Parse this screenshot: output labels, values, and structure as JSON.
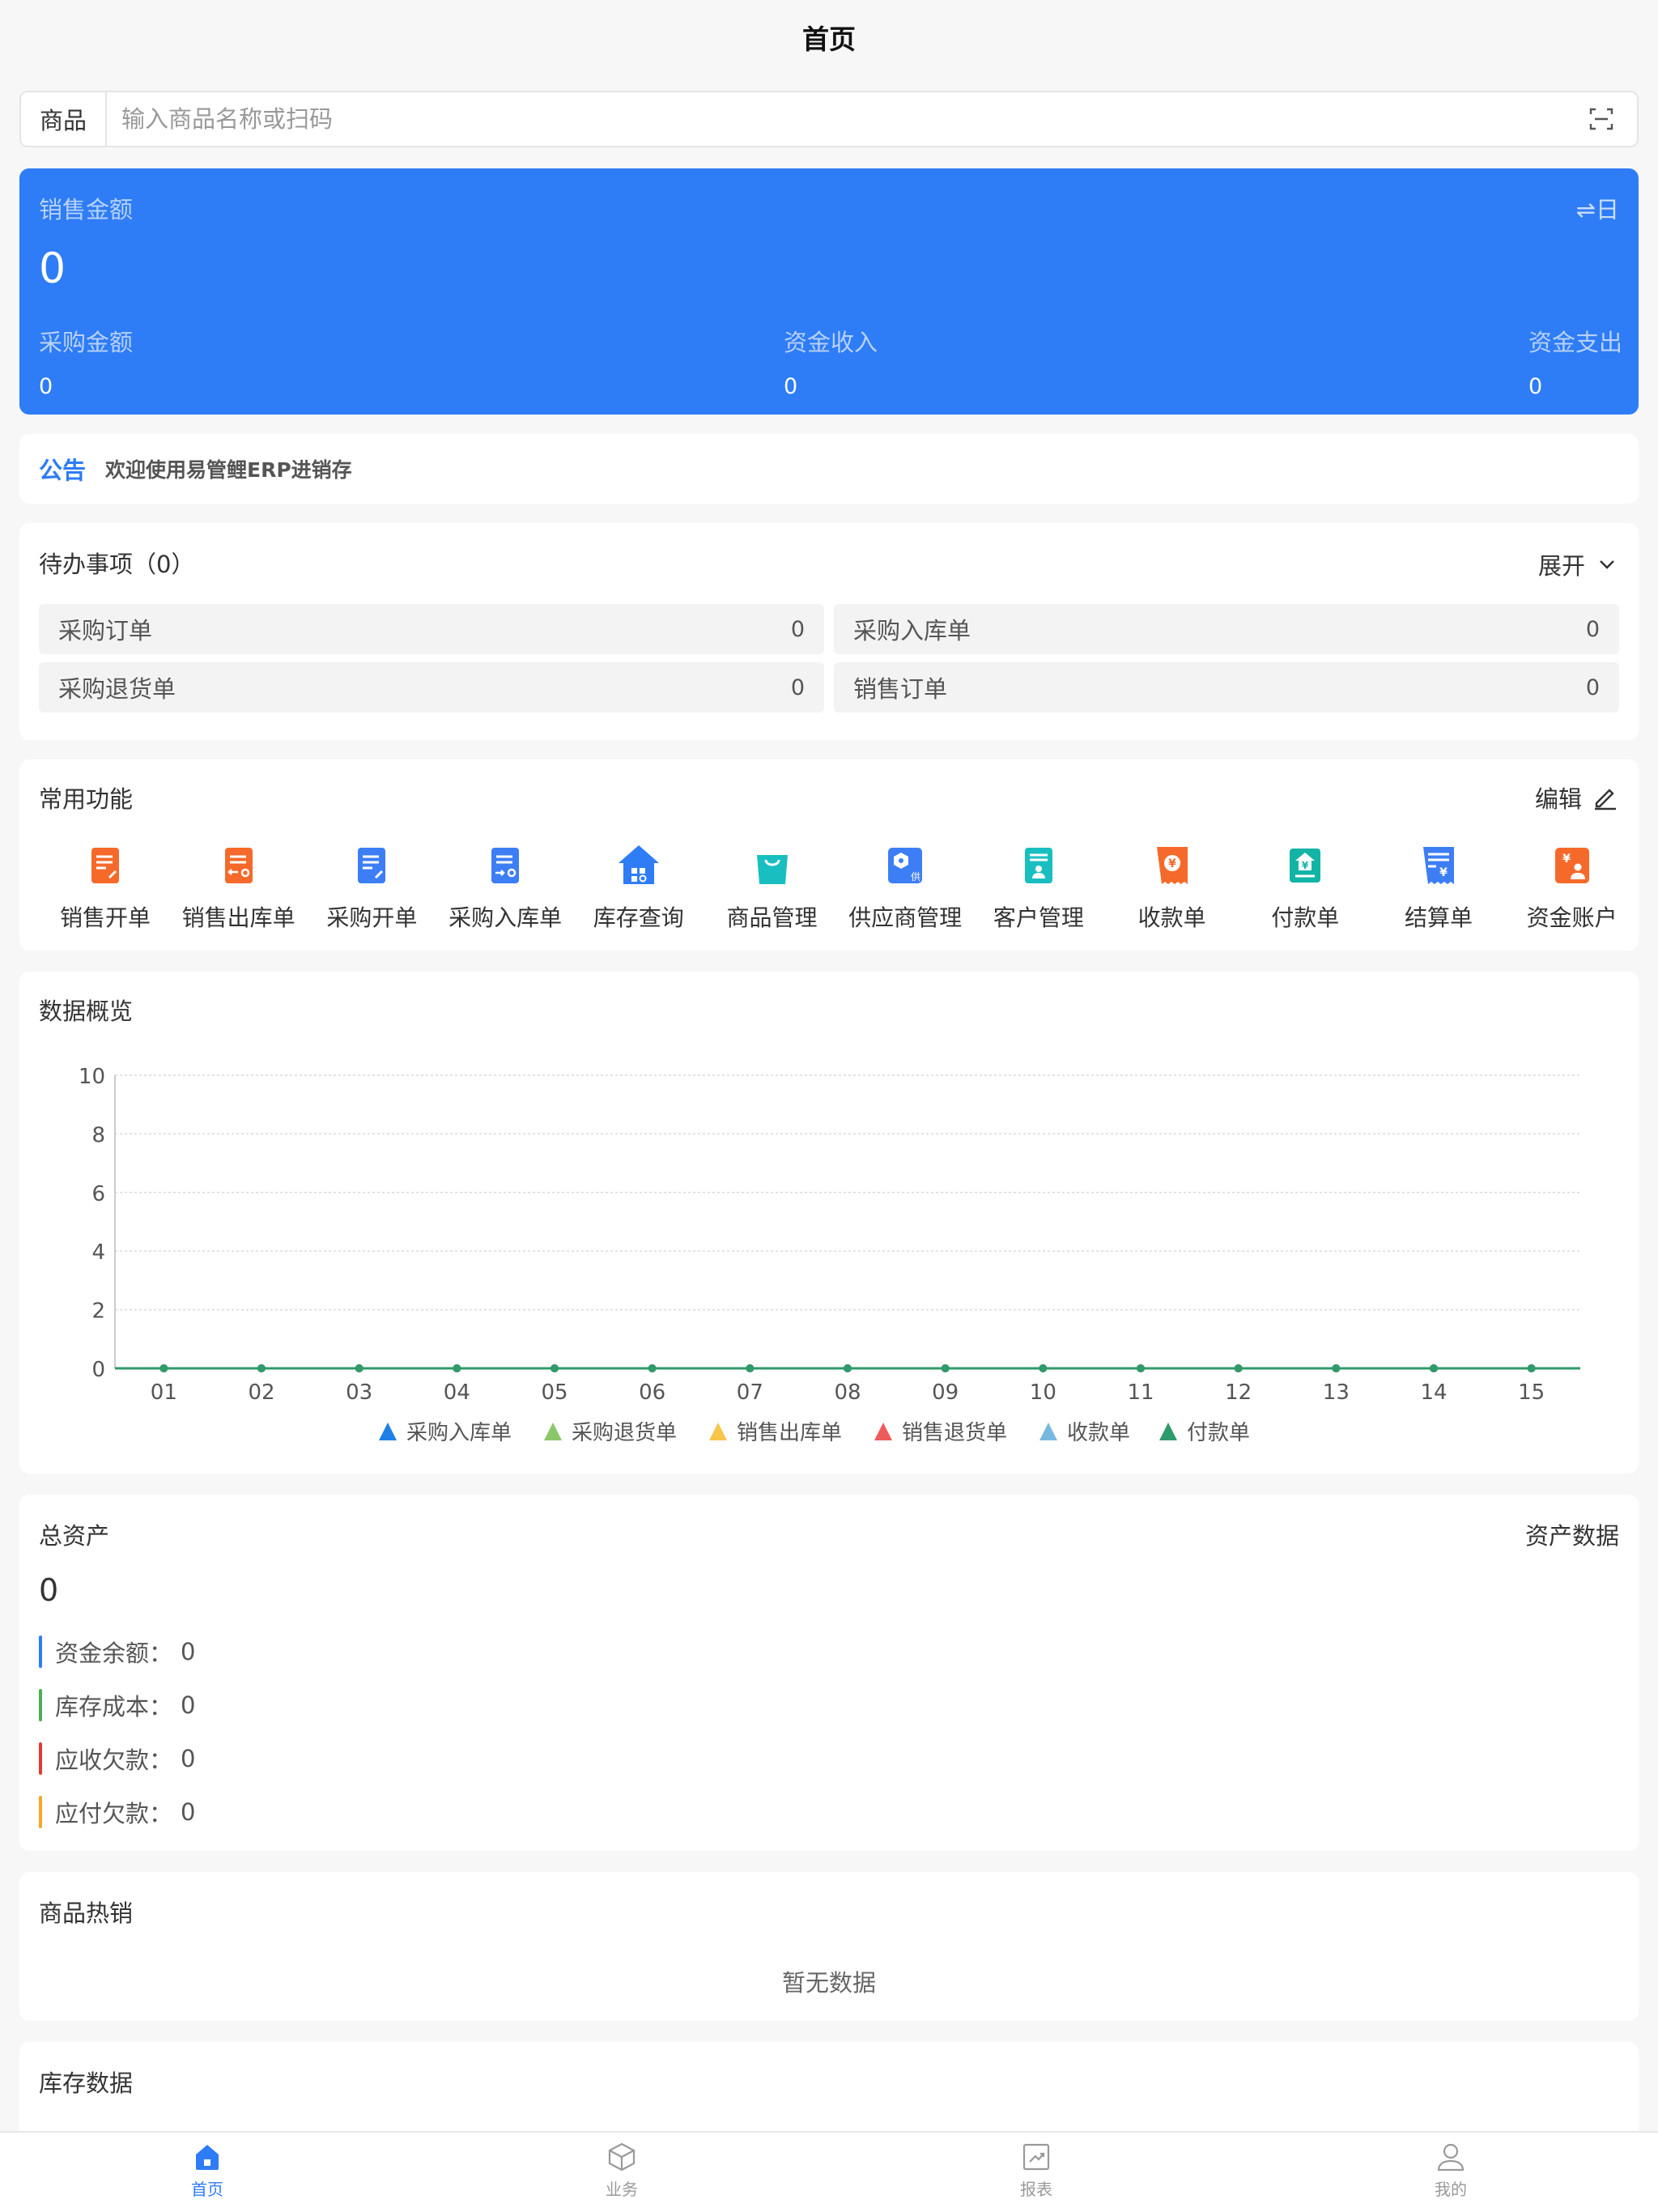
{
  "header": {
    "title": "首页"
  },
  "search": {
    "label": "商品",
    "placeholder": "输入商品名称或扫码"
  },
  "sales": {
    "label": "销售金额",
    "toggle": "⇌日",
    "value": "0",
    "subs": [
      {
        "label": "采购金额",
        "value": "0"
      },
      {
        "label": "资金收入",
        "value": "0"
      },
      {
        "label": "资金支出",
        "value": "0"
      }
    ]
  },
  "notice": {
    "label": "公告",
    "text": "欢迎使用易管鲤ERP进销存"
  },
  "todo": {
    "title": "待办事项（0）",
    "expand": "展开",
    "items": [
      {
        "label": "采购订单",
        "count": "0"
      },
      {
        "label": "采购入库单",
        "count": "0"
      },
      {
        "label": "采购退货单",
        "count": "0"
      },
      {
        "label": "销售订单",
        "count": "0"
      }
    ]
  },
  "functions": {
    "title": "常用功能",
    "edit": "编辑",
    "items": [
      {
        "label": "销售开单",
        "icon": "sales-order-icon",
        "color": "#f56a2a"
      },
      {
        "label": "销售出库单",
        "icon": "sales-outbound-icon",
        "color": "#f56a2a"
      },
      {
        "label": "采购开单",
        "icon": "purchase-order-icon",
        "color": "#3d7ef5"
      },
      {
        "label": "采购入库单",
        "icon": "purchase-inbound-icon",
        "color": "#3d7ef5"
      },
      {
        "label": "库存查询",
        "icon": "inventory-query-icon",
        "color": "#2e7cf6"
      },
      {
        "label": "商品管理",
        "icon": "product-management-icon",
        "color": "#19bfc0"
      },
      {
        "label": "供应商管理",
        "icon": "supplier-management-icon",
        "color": "#3d7ef5"
      },
      {
        "label": "客户管理",
        "icon": "customer-management-icon",
        "color": "#19bfc0"
      },
      {
        "label": "收款单",
        "icon": "receipt-icon",
        "color": "#f56a2a"
      },
      {
        "label": "付款单",
        "icon": "payment-icon",
        "color": "#13b4a6"
      },
      {
        "label": "结算单",
        "icon": "settlement-icon",
        "color": "#3d7ef5"
      },
      {
        "label": "资金账户",
        "icon": "fund-account-icon",
        "color": "#f56a2a"
      }
    ]
  },
  "overview": {
    "title": "数据概览",
    "chart_data": {
      "type": "line",
      "x": [
        "01",
        "02",
        "03",
        "04",
        "05",
        "06",
        "07",
        "08",
        "09",
        "10",
        "11",
        "12",
        "13",
        "14",
        "15"
      ],
      "ylim": [
        0,
        10
      ],
      "yticks": [
        "0",
        "2",
        "4",
        "6",
        "8",
        "10"
      ],
      "grid": true,
      "legend": "bottom",
      "series": [
        {
          "name": "采购入库单",
          "color": "#1e7fe8",
          "values": [
            0,
            0,
            0,
            0,
            0,
            0,
            0,
            0,
            0,
            0,
            0,
            0,
            0,
            0,
            0
          ]
        },
        {
          "name": "采购退货单",
          "color": "#8cc56a",
          "values": [
            0,
            0,
            0,
            0,
            0,
            0,
            0,
            0,
            0,
            0,
            0,
            0,
            0,
            0,
            0
          ]
        },
        {
          "name": "销售出库单",
          "color": "#f8c54a",
          "values": [
            0,
            0,
            0,
            0,
            0,
            0,
            0,
            0,
            0,
            0,
            0,
            0,
            0,
            0,
            0
          ]
        },
        {
          "name": "销售退货单",
          "color": "#ee5b5b",
          "values": [
            0,
            0,
            0,
            0,
            0,
            0,
            0,
            0,
            0,
            0,
            0,
            0,
            0,
            0,
            0
          ]
        },
        {
          "name": "收款单",
          "color": "#79b8de",
          "values": [
            0,
            0,
            0,
            0,
            0,
            0,
            0,
            0,
            0,
            0,
            0,
            0,
            0,
            0,
            0
          ]
        },
        {
          "name": "付款单",
          "color": "#2f9a6a",
          "values": [
            0,
            0,
            0,
            0,
            0,
            0,
            0,
            0,
            0,
            0,
            0,
            0,
            0,
            0,
            0
          ]
        }
      ]
    }
  },
  "assets": {
    "title": "总资产",
    "link": "资产数据",
    "total": "0",
    "rows": [
      {
        "label": "资金余额：",
        "value": "0",
        "color": "#2e7cf6"
      },
      {
        "label": "库存成本：",
        "value": "0",
        "color": "#4caf50"
      },
      {
        "label": "应收欠款：",
        "value": "0",
        "color": "#e53935"
      },
      {
        "label": "应付欠款：",
        "value": "0",
        "color": "#f5a623"
      }
    ]
  },
  "hot_products": {
    "title": "商品热销",
    "empty": "暂无数据"
  },
  "stock": {
    "title": "库存数据"
  },
  "tabbar": [
    {
      "label": "首页",
      "icon": "home-icon",
      "active": true
    },
    {
      "label": "业务",
      "icon": "business-icon",
      "active": false
    },
    {
      "label": "报表",
      "icon": "report-icon",
      "active": false
    },
    {
      "label": "我的",
      "icon": "profile-icon",
      "active": false
    }
  ]
}
